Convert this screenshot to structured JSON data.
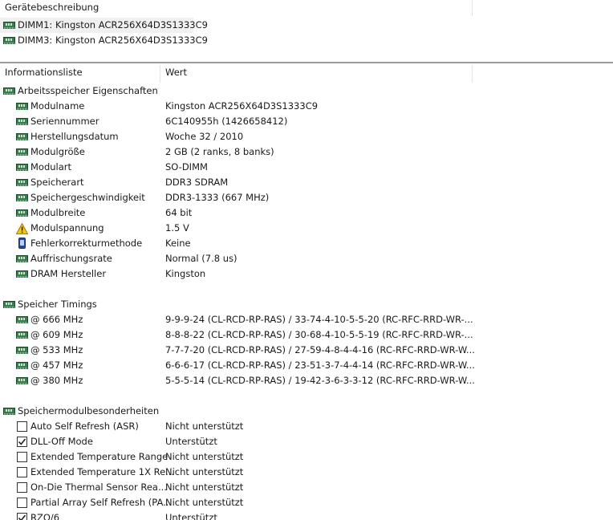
{
  "device_panel": {
    "header": "Gerätebeschreibung",
    "devices": [
      {
        "label": "DIMM1: Kingston ACR256X64D3S1333C9",
        "selected": true
      },
      {
        "label": "DIMM3: Kingston ACR256X64D3S1333C9",
        "selected": false
      }
    ]
  },
  "info_panel": {
    "col_name": "Informationsliste",
    "col_value": "Wert",
    "groups": [
      {
        "title": "Arbeitsspeicher Eigenschaften",
        "icon": "ram-icon",
        "items": [
          {
            "name": "Modulname",
            "value": "Kingston ACR256X64D3S1333C9",
            "icon": "ram-icon"
          },
          {
            "name": "Seriennummer",
            "value": "6C140955h (1426658412)",
            "icon": "ram-icon"
          },
          {
            "name": "Herstellungsdatum",
            "value": "Woche 32 / 2010",
            "icon": "ram-icon"
          },
          {
            "name": "Modulgröße",
            "value": "2 GB (2 ranks, 8 banks)",
            "icon": "ram-icon"
          },
          {
            "name": "Modulart",
            "value": "SO-DIMM",
            "icon": "ram-icon"
          },
          {
            "name": "Speicherart",
            "value": "DDR3 SDRAM",
            "icon": "ram-icon"
          },
          {
            "name": "Speichergeschwindigkeit",
            "value": "DDR3-1333 (667 MHz)",
            "icon": "ram-icon"
          },
          {
            "name": "Modulbreite",
            "value": "64 bit",
            "icon": "ram-icon"
          },
          {
            "name": "Modulspannung",
            "value": "1.5 V",
            "icon": "warning-icon"
          },
          {
            "name": "Fehlerkorrekturmethode",
            "value": "Keine",
            "icon": "phone-icon"
          },
          {
            "name": "Auffrischungsrate",
            "value": "Normal (7.8 us)",
            "icon": "ram-icon"
          },
          {
            "name": "DRAM Hersteller",
            "value": "Kingston",
            "icon": "ram-icon"
          }
        ]
      },
      {
        "title": "Speicher Timings",
        "icon": "ram-icon",
        "items": [
          {
            "name": "@ 666 MHz",
            "value": "9-9-9-24  (CL-RCD-RP-RAS) / 33-74-4-10-5-5-20  (RC-RFC-RRD-WR-...",
            "icon": "ram-icon"
          },
          {
            "name": "@ 609 MHz",
            "value": "8-8-8-22  (CL-RCD-RP-RAS) / 30-68-4-10-5-5-19  (RC-RFC-RRD-WR-...",
            "icon": "ram-icon"
          },
          {
            "name": "@ 533 MHz",
            "value": "7-7-7-20  (CL-RCD-RP-RAS) / 27-59-4-8-4-4-16  (RC-RFC-RRD-WR-W...",
            "icon": "ram-icon"
          },
          {
            "name": "@ 457 MHz",
            "value": "6-6-6-17  (CL-RCD-RP-RAS) / 23-51-3-7-4-4-14  (RC-RFC-RRD-WR-W...",
            "icon": "ram-icon"
          },
          {
            "name": "@ 380 MHz",
            "value": "5-5-5-14  (CL-RCD-RP-RAS) / 19-42-3-6-3-3-12  (RC-RFC-RRD-WR-W...",
            "icon": "ram-icon"
          }
        ]
      },
      {
        "title": "Speichermodulbesonderheiten",
        "icon": "ram-icon",
        "items": [
          {
            "name": "Auto Self Refresh (ASR)",
            "value": "Nicht unterstützt",
            "checked": false
          },
          {
            "name": "DLL-Off Mode",
            "value": "Unterstützt",
            "checked": true
          },
          {
            "name": "Extended Temperature Range",
            "value": "Nicht unterstützt",
            "checked": false
          },
          {
            "name": "Extended Temperature 1X Re...",
            "value": "Nicht unterstützt",
            "checked": false
          },
          {
            "name": "On-Die Thermal Sensor Rea...",
            "value": "Nicht unterstützt",
            "checked": false
          },
          {
            "name": "Partial Array Self Refresh (PA...",
            "value": "Nicht unterstützt",
            "checked": false
          },
          {
            "name": "RZQ/6",
            "value": "Unterstützt",
            "checked": true
          }
        ]
      }
    ]
  },
  "colors": {
    "selection_bg": "#f0f0f0",
    "ram_icon_green": "#3c7a4f",
    "warning_yellow": "#f5c518"
  }
}
